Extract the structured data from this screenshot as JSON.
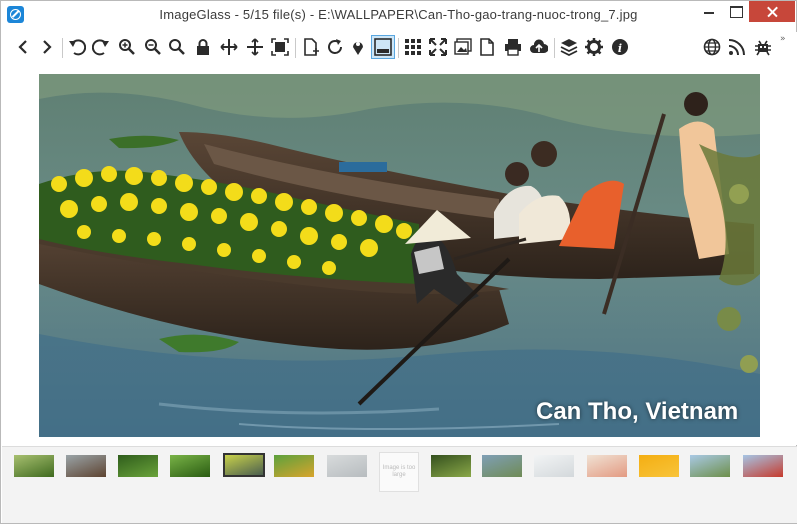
{
  "window": {
    "title": "ImageGlass - 5/15 file(s) - E:\\WALLPAPER\\Can-Tho-gao-trang-nuoc-trong_7.jpg",
    "app_icon": "imageglass-logo-icon"
  },
  "window_controls": [
    "minimize-icon",
    "maximize-icon",
    "close-icon"
  ],
  "toolbar": {
    "buttons": [
      {
        "name": "back-icon",
        "group": 1
      },
      {
        "name": "forward-icon",
        "group": 1
      },
      {
        "name": "rotate-left-icon",
        "group": 2
      },
      {
        "name": "rotate-right-icon",
        "group": 2
      },
      {
        "name": "zoom-in-icon",
        "group": 2
      },
      {
        "name": "zoom-out-icon",
        "group": 2
      },
      {
        "name": "zoom-actual-icon",
        "group": 2
      },
      {
        "name": "lock-zoom-icon",
        "group": 2
      },
      {
        "name": "fit-width-icon",
        "group": 2
      },
      {
        "name": "fit-height-icon",
        "group": 2
      },
      {
        "name": "fit-window-icon",
        "group": 2
      },
      {
        "name": "open-file-icon",
        "group": 3
      },
      {
        "name": "refresh-icon",
        "group": 3
      },
      {
        "name": "goto-location-icon",
        "group": 3
      },
      {
        "name": "thumbnail-bar-icon",
        "group": 3,
        "active": true
      },
      {
        "name": "checkerboard-icon",
        "group": 4
      },
      {
        "name": "fullscreen-icon",
        "group": 4
      },
      {
        "name": "slideshow-icon",
        "group": 4
      },
      {
        "name": "convert-icon",
        "group": 4
      },
      {
        "name": "print-icon",
        "group": 4
      },
      {
        "name": "upload-icon",
        "group": 4
      },
      {
        "name": "extension-icon",
        "group": 5
      },
      {
        "name": "settings-icon",
        "group": 5
      },
      {
        "name": "about-icon",
        "group": 5
      },
      {
        "name": "website-icon",
        "group": 6
      },
      {
        "name": "rss-icon",
        "group": 6
      },
      {
        "name": "report-bug-icon",
        "group": 6
      }
    ],
    "overflow_glyph": "»"
  },
  "viewer": {
    "caption": "Can Tho, Vietnam",
    "background": "#ffffff"
  },
  "thumbnails": [
    {
      "name": "thumb-forest",
      "colors": [
        "#a8c070",
        "#3f6a1f"
      ]
    },
    {
      "name": "thumb-wood",
      "colors": [
        "#9aa4a8",
        "#5d4330"
      ]
    },
    {
      "name": "thumb-leaves",
      "colors": [
        "#2f5d1c",
        "#6aa33a"
      ]
    },
    {
      "name": "thumb-grass",
      "colors": [
        "#79b347",
        "#2a5c12"
      ]
    },
    {
      "name": "thumb-boat",
      "colors": [
        "#c9d24a",
        "#4b5f4f"
      ],
      "selected": true
    },
    {
      "name": "thumb-bird",
      "colors": [
        "#5ca13d",
        "#d8a42c"
      ]
    },
    {
      "name": "thumb-mist",
      "colors": [
        "#d8dbdc",
        "#b7bcbf"
      ]
    },
    {
      "name": "thumb-placeholder",
      "text": "Image is too large",
      "placeholder": true
    },
    {
      "name": "thumb-jungle",
      "colors": [
        "#34501e",
        "#8aa848"
      ]
    },
    {
      "name": "thumb-mountain",
      "colors": [
        "#7f9fb6",
        "#6f8b55"
      ]
    },
    {
      "name": "thumb-lighthouse",
      "colors": [
        "#f2f4f5",
        "#d3d8db"
      ]
    },
    {
      "name": "thumb-deer",
      "colors": [
        "#f0e2d4",
        "#e39a82"
      ]
    },
    {
      "name": "thumb-sunset",
      "colors": [
        "#f4ae12",
        "#f8c43a"
      ]
    },
    {
      "name": "thumb-field",
      "colors": [
        "#a9c9e5",
        "#6d8f4a"
      ]
    },
    {
      "name": "thumb-heart",
      "colors": [
        "#a5c5e5",
        "#c63a2c"
      ]
    }
  ]
}
